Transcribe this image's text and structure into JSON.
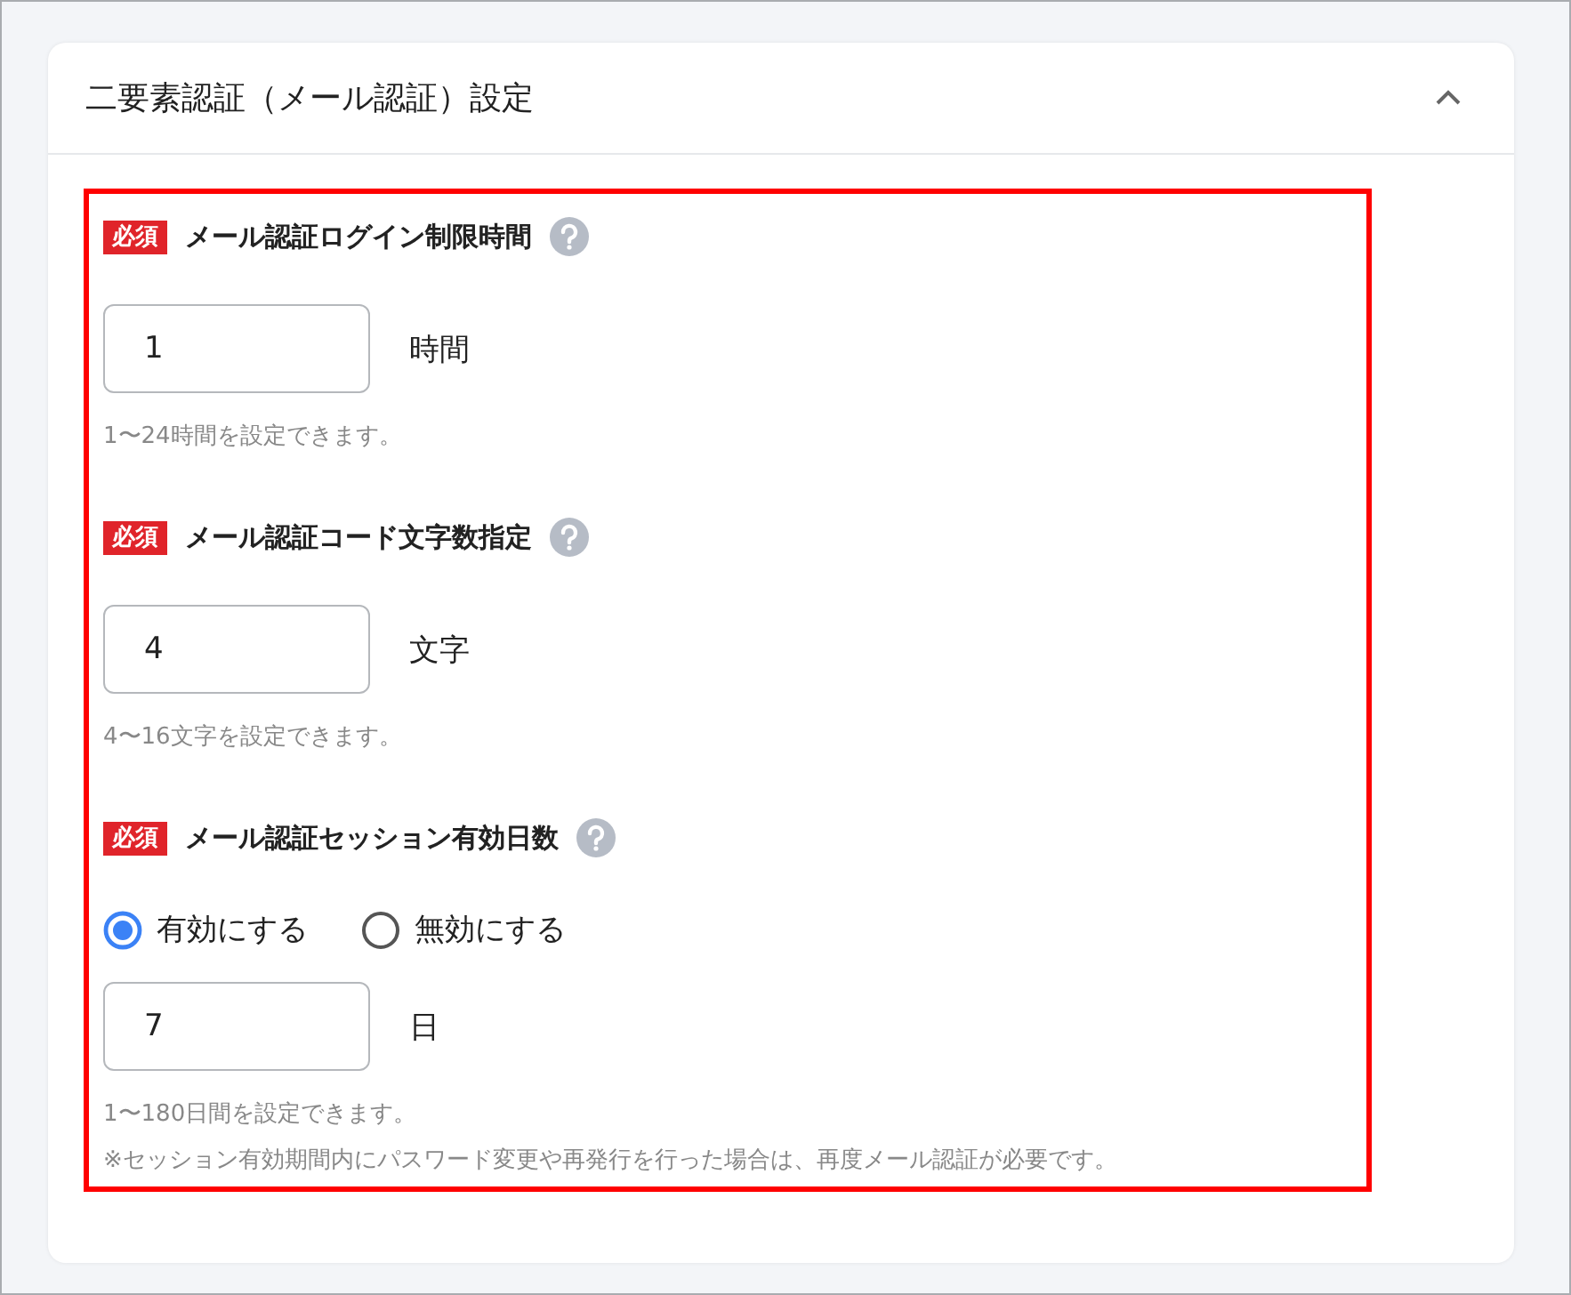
{
  "panel": {
    "title": "二要素認証（メール認証）設定",
    "expanded": true
  },
  "fields": [
    {
      "required_badge": "必須",
      "label": "メール認証ログイン制限時間",
      "value": "1",
      "unit": "時間",
      "hints": [
        "1〜24時間を設定できます。"
      ]
    },
    {
      "required_badge": "必須",
      "label": "メール認証コード文字数指定",
      "value": "4",
      "unit": "文字",
      "hints": [
        "4〜16文字を設定できます。"
      ]
    },
    {
      "required_badge": "必須",
      "label": "メール認証セッション有効日数",
      "options": [
        {
          "label": "有効にする",
          "selected": true
        },
        {
          "label": "無効にする",
          "selected": false
        }
      ],
      "value": "7",
      "unit": "日",
      "hints": [
        "1〜180日間を設定できます。",
        "※セッション有効期間内にパスワード変更や再発行を行った場合は、再度メール認証が必要です。"
      ]
    }
  ]
}
